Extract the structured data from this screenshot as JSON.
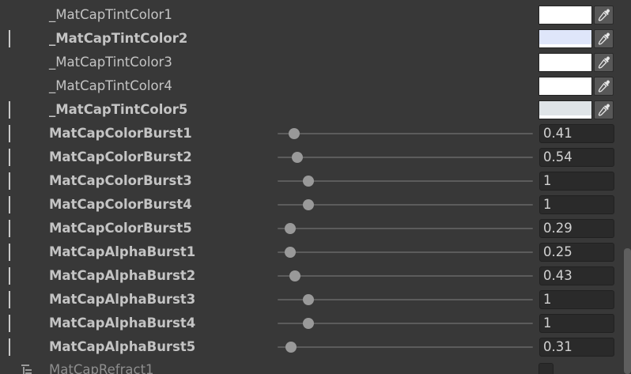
{
  "color_rows": [
    {
      "label": "_MatCapTintColor1",
      "overridden": false,
      "color": "#ffffff",
      "strip": "#ffffff"
    },
    {
      "label": "_MatCapTintColor2",
      "overridden": true,
      "color": "#dfe6fa",
      "strip": "#ffffff"
    },
    {
      "label": "_MatCapTintColor3",
      "overridden": false,
      "color": "#ffffff",
      "strip": "#ffffff"
    },
    {
      "label": "_MatCapTintColor4",
      "overridden": false,
      "color": "#ffffff",
      "strip": "#ffffff"
    },
    {
      "label": "_MatCapTintColor5",
      "overridden": true,
      "color": "#dfe4e7",
      "strip": "#ffffff"
    }
  ],
  "slider_rows": [
    {
      "label": "MatCapColorBurst1",
      "value": "0.41",
      "fraction": 0.064
    },
    {
      "label": "MatCapColorBurst2",
      "value": "0.54",
      "fraction": 0.076
    },
    {
      "label": "MatCapColorBurst3",
      "value": "1",
      "fraction": 0.121
    },
    {
      "label": "MatCapColorBurst4",
      "value": "1",
      "fraction": 0.121
    },
    {
      "label": "MatCapColorBurst5",
      "value": "0.29",
      "fraction": 0.051
    },
    {
      "label": "MatCapAlphaBurst1",
      "value": "0.25",
      "fraction": 0.048
    },
    {
      "label": "MatCapAlphaBurst2",
      "value": "0.43",
      "fraction": 0.067
    },
    {
      "label": "MatCapAlphaBurst3",
      "value": "1",
      "fraction": 0.121
    },
    {
      "label": "MatCapAlphaBurst4",
      "value": "1",
      "fraction": 0.121
    },
    {
      "label": "MatCapAlphaBurst5",
      "value": "0.31",
      "fraction": 0.054
    }
  ],
  "partial_row": {
    "label": "MatCapRefract1",
    "icon": "tree-list-icon"
  },
  "colors": {
    "background": "#383838",
    "override_bar": "#c8c8c8",
    "slider_thumb": "#999999",
    "field_bg": "#2a2a2a"
  }
}
